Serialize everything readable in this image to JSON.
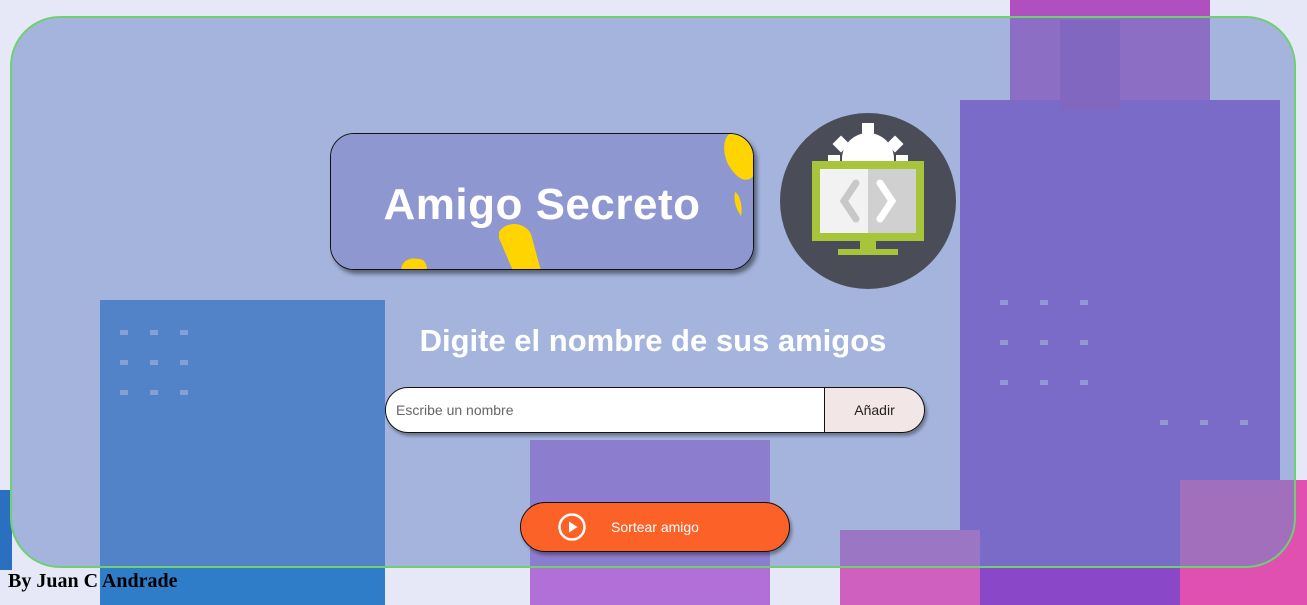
{
  "app": {
    "title": "Amigo Secreto",
    "author": "By Juan C Andrade"
  },
  "header": {
    "title": "Amigo Secreto",
    "logo_icon": "code-monitor-gear-icon"
  },
  "main": {
    "subtitle": "Digite el nombre de sus amigos",
    "input": {
      "value": "",
      "placeholder": "Escribe un nombre"
    },
    "add_button_label": "Añadir",
    "draw_button_label": "Sortear amigo",
    "draw_button_icon": "play-circle-icon"
  },
  "colors": {
    "card_border": "#6fcf73",
    "draw_button": "#fc6128",
    "add_button": "#f3e6e6",
    "accent_yellow": "#ffd400"
  }
}
